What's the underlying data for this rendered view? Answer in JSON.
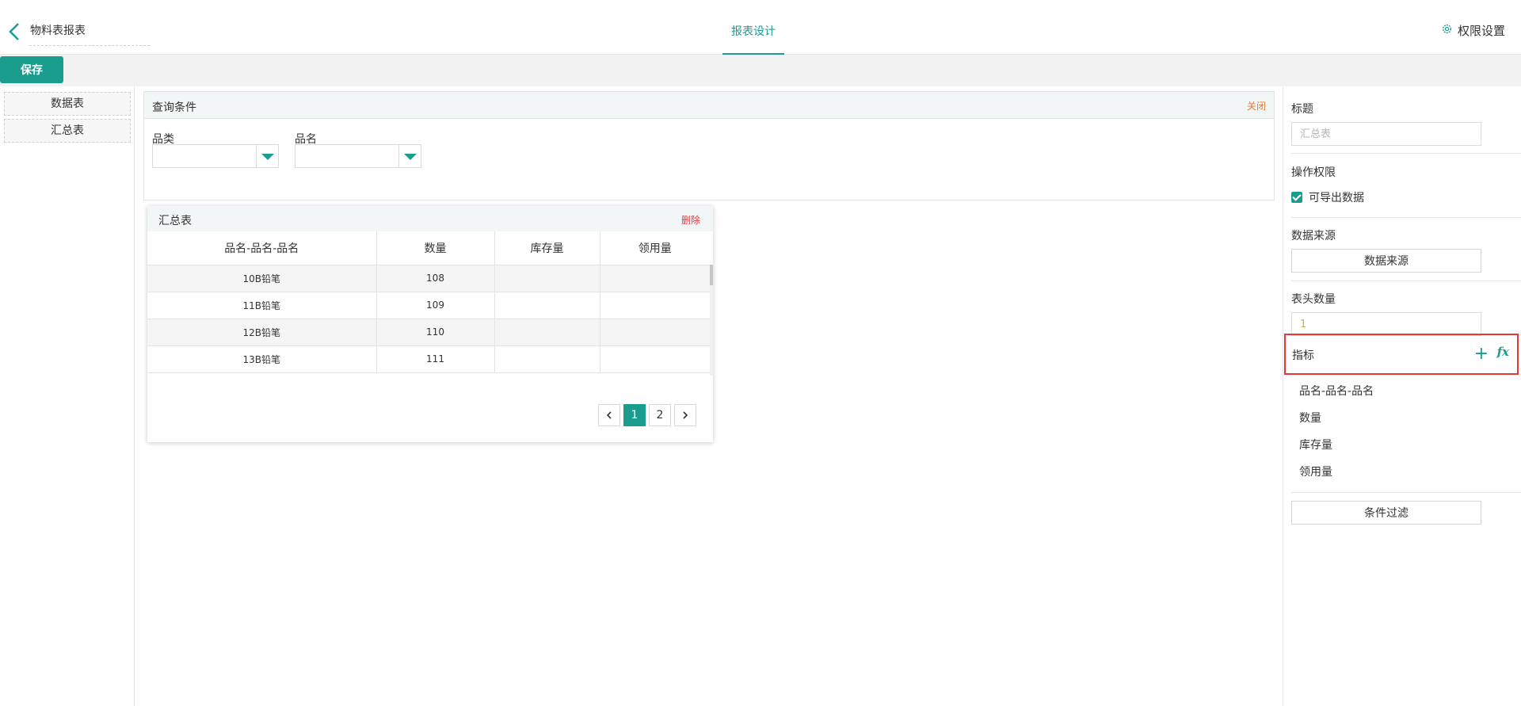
{
  "header": {
    "report_name": "物料表报表",
    "center_tab": "报表设计",
    "settings_label": "权限设置",
    "settings_icon": "gear-icon",
    "back_icon": "chevron-left-icon"
  },
  "toolbar": {
    "save_label": "保存"
  },
  "left_panel": {
    "items": [
      {
        "label": "数据表"
      },
      {
        "label": "汇总表"
      }
    ]
  },
  "query": {
    "title": "查询条件",
    "close_label": "关闭",
    "fields": [
      {
        "label": "品类",
        "value": ""
      },
      {
        "label": "品名",
        "value": ""
      }
    ]
  },
  "summary_table": {
    "title": "汇总表",
    "delete_label": "删除",
    "columns": [
      "品名-品名-品名",
      "数量",
      "库存量",
      "领用量"
    ],
    "rows": [
      [
        "10B铅笔",
        "108",
        "",
        ""
      ],
      [
        "11B铅笔",
        "109",
        "",
        ""
      ],
      [
        "12B铅笔",
        "110",
        "",
        ""
      ],
      [
        "13B铅笔",
        "111",
        "",
        ""
      ]
    ],
    "pagination": {
      "pages": [
        "1",
        "2"
      ],
      "current": "1"
    }
  },
  "settings": {
    "title_label": "标题",
    "title_placeholder": "汇总表",
    "permission_label": "操作权限",
    "export_label": "可导出数据",
    "export_checked": true,
    "datasource_label": "数据来源",
    "datasource_button": "数据来源",
    "header_count_label": "表头数量",
    "header_count_value": "1",
    "metrics_label": "指标",
    "metrics_add": "+",
    "metrics_fx": "fx",
    "metrics": [
      "品名-品名-品名",
      "数量",
      "库存量",
      "领用量"
    ],
    "filter_button": "条件过滤"
  },
  "colors": {
    "accent": "#1a9d8f",
    "danger": "#e0393e",
    "warning": "#e07a3a",
    "highlight_border": "#e53935"
  }
}
